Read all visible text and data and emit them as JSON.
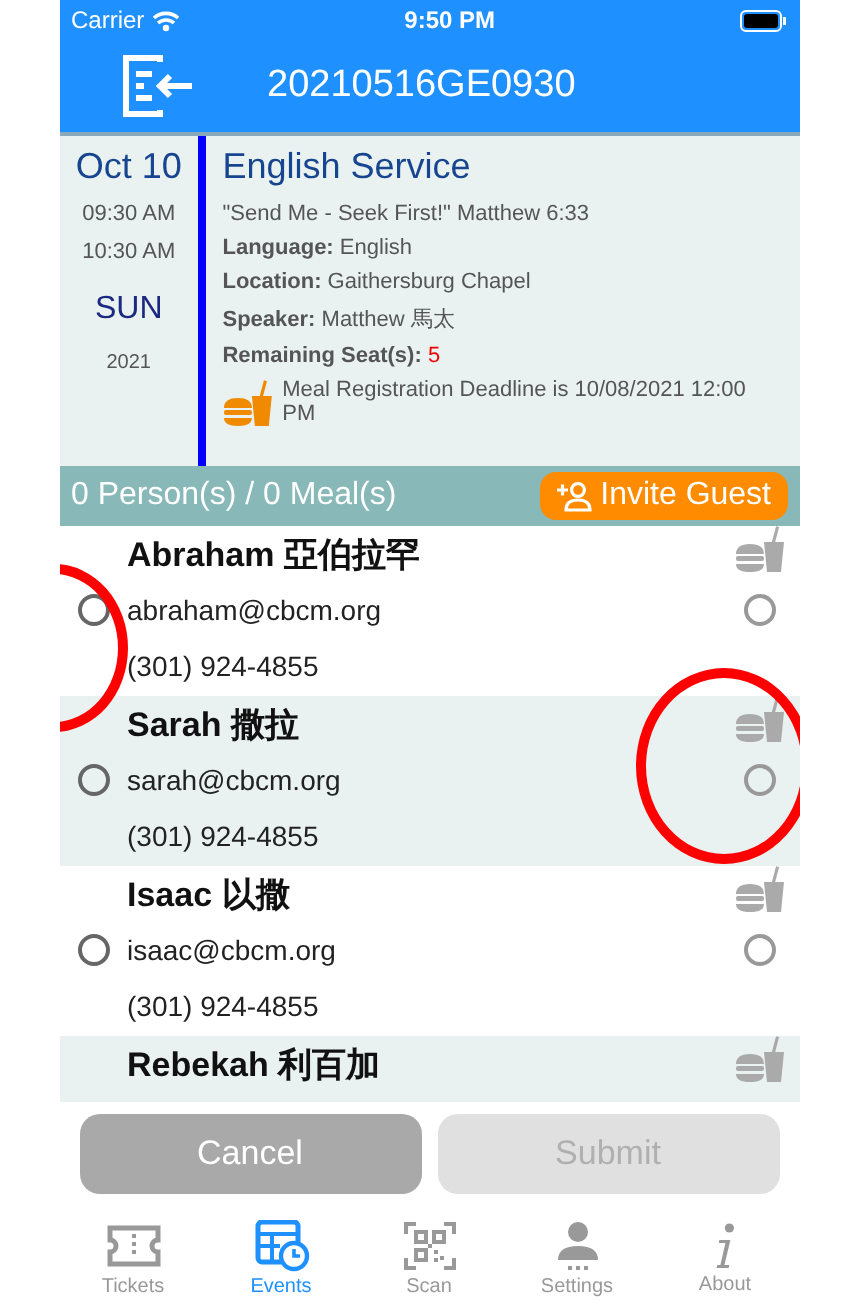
{
  "status_bar": {
    "carrier": "Carrier",
    "time": "9:50 PM"
  },
  "header": {
    "title": "20210516GE0930"
  },
  "event": {
    "date": "Oct 10",
    "start_time": "09:30 AM",
    "end_time": "10:30 AM",
    "weekday": "SUN",
    "year": "2021",
    "title": "English Service",
    "subtitle": "\"Send Me - Seek First!\" Matthew 6:33",
    "details": [
      {
        "label": "Language:",
        "value": "English"
      },
      {
        "label": "Location:",
        "value": "Gaithersburg Chapel"
      },
      {
        "label": "Speaker:",
        "value": "Matthew 馬太"
      },
      {
        "label": "Remaining Seat(s):",
        "value": "5",
        "kind": "alert"
      }
    ],
    "meal_deadline": "Meal Registration Deadline is 10/08/2021 12:00 PM"
  },
  "summary": {
    "text": "0 Person(s) / 0 Meal(s)",
    "invite_button": "Invite Guest"
  },
  "attendees": [
    {
      "name": "Abraham 亞伯拉罕",
      "email": "abraham@cbcm.org",
      "phone": "(301) 924-4855",
      "selected": false,
      "meal": false
    },
    {
      "name": "Sarah 撒拉",
      "email": "sarah@cbcm.org",
      "phone": "(301) 924-4855",
      "selected": false,
      "meal": false
    },
    {
      "name": "Isaac 以撒",
      "email": "isaac@cbcm.org",
      "phone": "(301) 924-4855",
      "selected": false,
      "meal": false
    },
    {
      "name": "Rebekah 利百加"
    }
  ],
  "buttons": [
    {
      "label": "Cancel",
      "disabled": false
    },
    {
      "label": "Submit",
      "disabled": true
    }
  ],
  "tabs": [
    {
      "label": "Tickets",
      "selected": false
    },
    {
      "label": "Events",
      "selected": true
    },
    {
      "label": "Scan",
      "selected": false
    },
    {
      "label": "Settings",
      "selected": false
    },
    {
      "label": "About",
      "selected": false
    }
  ]
}
